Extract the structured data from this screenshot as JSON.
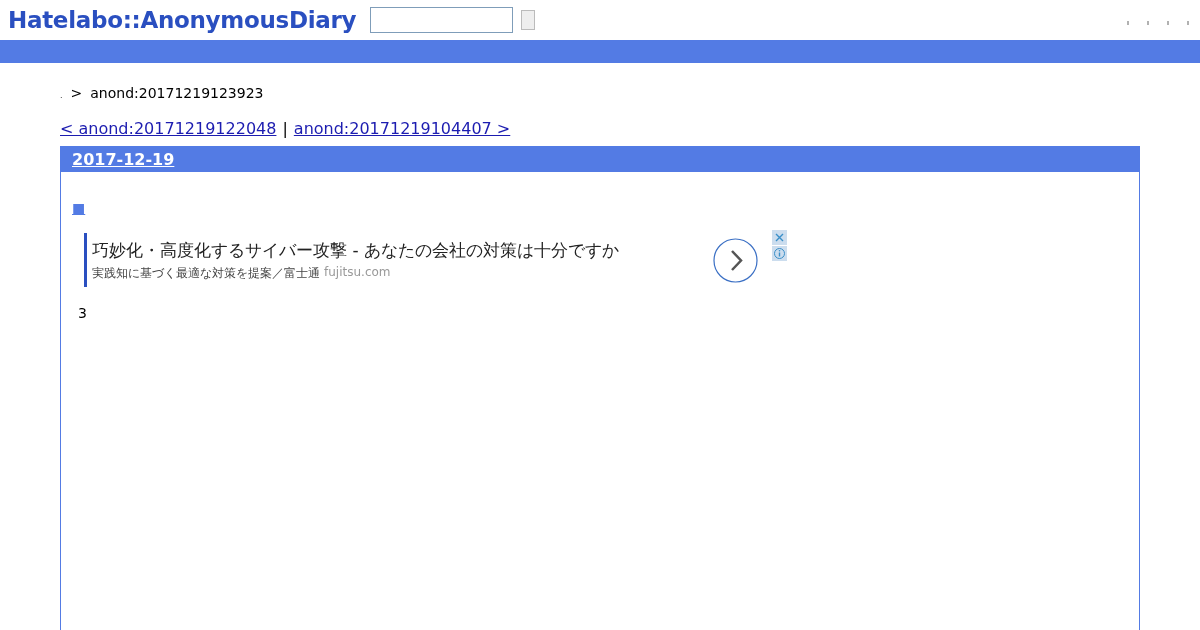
{
  "header": {
    "logo": "Hatelabo::AnonymousDiary"
  },
  "breadcrumb": {
    "home": ".",
    "separator": ">",
    "current": "anond:20171219123923"
  },
  "pager": {
    "prev": "< anond:20171219122048",
    "separator": "|",
    "next": "anond:20171219104407 >"
  },
  "day": {
    "date": "2017-12-19",
    "section_mark": "■",
    "ad": {
      "headline": "巧妙化・高度化するサイバー攻撃 - あなたの会社の対策は十分ですか",
      "description": "実践知に基づく最適な対策を提案／富士通",
      "domain": "fujitsu.com"
    },
    "body": "3"
  }
}
